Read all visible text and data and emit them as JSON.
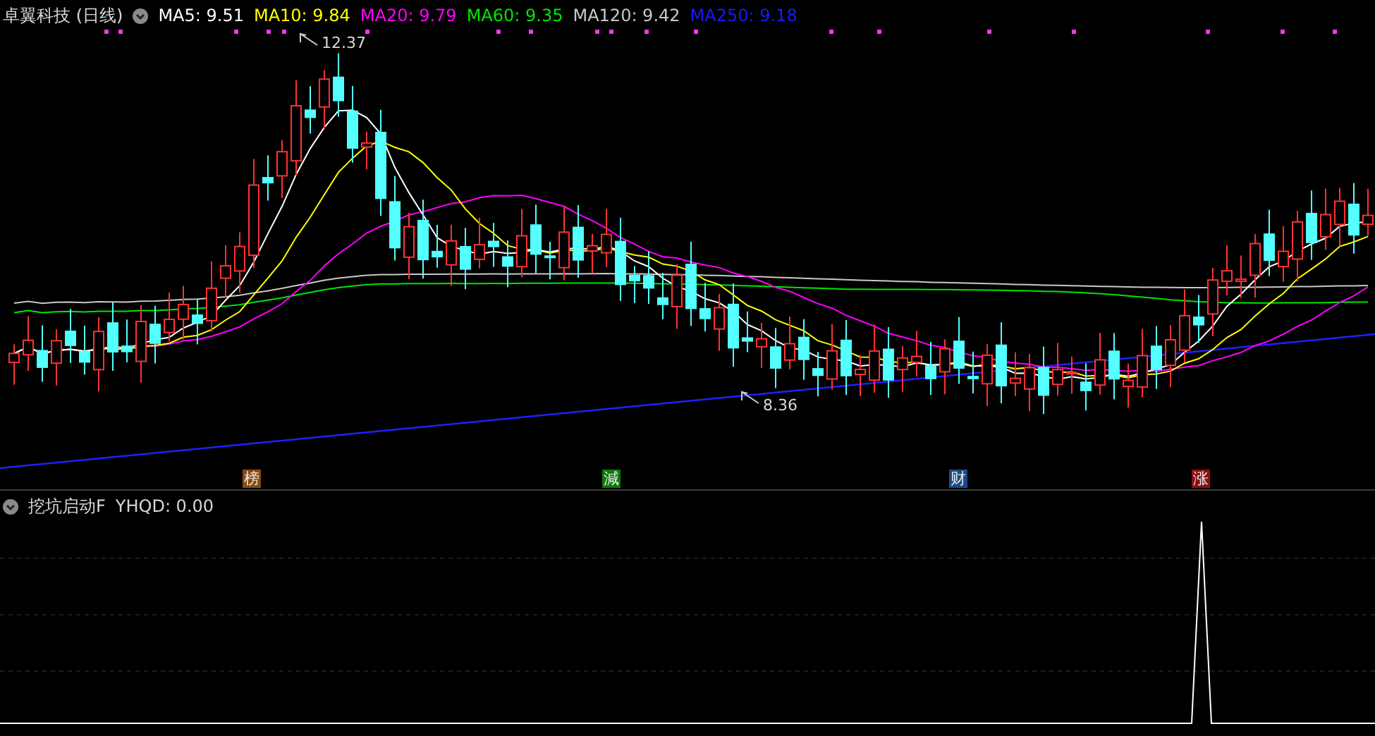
{
  "main_panel": {
    "title": "卓翼科技 (日线)",
    "ma_legend": [
      {
        "label": "MA5: 9.51",
        "color": "#ffffff"
      },
      {
        "label": "MA10: 9.84",
        "color": "#ffff00"
      },
      {
        "label": "MA20: 9.79",
        "color": "#ff00ff"
      },
      {
        "label": "MA60: 9.35",
        "color": "#00e600"
      },
      {
        "label": "MA120: 9.42",
        "color": "#c8c8c8"
      },
      {
        "label": "MA250: 9.18",
        "color": "#1a1aff"
      }
    ],
    "price_labels": [
      {
        "kind": "high",
        "text": "12.37"
      },
      {
        "kind": "low",
        "text": "8.36"
      }
    ],
    "event_tags": [
      {
        "text": "榜",
        "color": "#8a4a10"
      },
      {
        "text": "減",
        "color": "#0a7a0a"
      },
      {
        "text": "财",
        "color": "#1a4a8a"
      },
      {
        "text": "涨",
        "color": "#8a1010"
      }
    ]
  },
  "indicator_panel": {
    "title": "挖坑启动F",
    "reading": "YHQD: 0.00"
  }
}
